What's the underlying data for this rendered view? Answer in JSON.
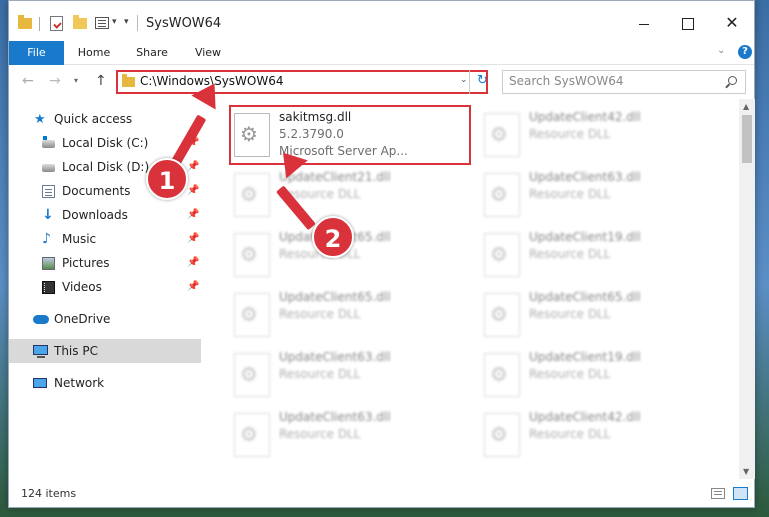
{
  "window": {
    "title": "SysWOW64"
  },
  "ribbon": {
    "tabs": [
      "File",
      "Home",
      "Share",
      "View"
    ]
  },
  "nav": {
    "address": "C:\\Windows\\SysWOW64",
    "search_placeholder": "Search SysWOW64"
  },
  "sidebar": {
    "items": [
      {
        "label": "Quick access"
      },
      {
        "label": "Local Disk (C:)"
      },
      {
        "label": "Local Disk (D:)"
      },
      {
        "label": "Documents"
      },
      {
        "label": "Downloads"
      },
      {
        "label": "Music"
      },
      {
        "label": "Pictures"
      },
      {
        "label": "Videos"
      },
      {
        "label": "OneDrive"
      },
      {
        "label": "This PC"
      },
      {
        "label": "Network"
      }
    ]
  },
  "files": {
    "highlighted": {
      "name": "sakitmsg.dll",
      "version": "5.2.3790.0",
      "company": "Microsoft Server Ap..."
    },
    "col1": [
      {
        "name": "UpdateClient21.dll",
        "type": "Resource DLL"
      },
      {
        "name": "UpdateClient65.dll",
        "type": "Resource DLL"
      },
      {
        "name": "UpdateClient65.dll",
        "type": "Resource DLL"
      },
      {
        "name": "UpdateClient63.dll",
        "type": "Resource DLL"
      },
      {
        "name": "UpdateClient63.dll",
        "type": "Resource DLL"
      }
    ],
    "col2": [
      {
        "name": "UpdateClient42.dll",
        "type": "Resource DLL"
      },
      {
        "name": "UpdateClient63.dll",
        "type": "Resource DLL"
      },
      {
        "name": "UpdateClient19.dll",
        "type": "Resource DLL"
      },
      {
        "name": "UpdateClient65.dll",
        "type": "Resource DLL"
      },
      {
        "name": "UpdateClient19.dll",
        "type": "Resource DLL"
      },
      {
        "name": "UpdateClient42.dll",
        "type": "Resource DLL"
      }
    ]
  },
  "status": {
    "count": "124 items"
  },
  "annotations": {
    "step1": "1",
    "step2": "2"
  },
  "colors": {
    "accent": "#1979ca",
    "annotation": "#d9323b"
  }
}
